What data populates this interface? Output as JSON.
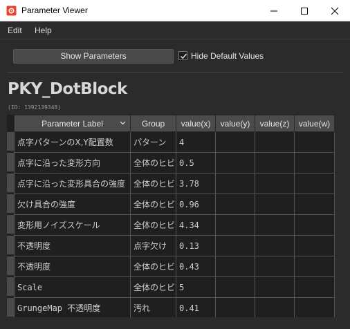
{
  "window": {
    "title": "Parameter Viewer"
  },
  "menu": [
    "Edit",
    "Help"
  ],
  "toolbar": {
    "show_button": "Show Parameters",
    "hide_default_label": "Hide Default Values",
    "hide_default_checked": true
  },
  "block": {
    "name": "PKY_DotBlock",
    "id_text": "(ID: 1392139348)"
  },
  "table": {
    "columns": [
      "Parameter Label",
      "Group",
      "value(x)",
      "value(y)",
      "value(z)",
      "value(w)"
    ],
    "rows": [
      {
        "label": "点字パターンのX,Y配置数",
        "group": "パターン",
        "x": "4",
        "y": "",
        "z": "",
        "w": ""
      },
      {
        "label": "点字に沿った変形方向",
        "group": "全体のヒビ",
        "x": "0.5",
        "y": "",
        "z": "",
        "w": ""
      },
      {
        "label": "点字に沿った変形具合の強度",
        "group": "全体のヒビ",
        "x": "3.78",
        "y": "",
        "z": "",
        "w": ""
      },
      {
        "label": "欠け具合の強度",
        "group": "全体のヒビ",
        "x": "0.96",
        "y": "",
        "z": "",
        "w": ""
      },
      {
        "label": "変形用ノイズスケール",
        "group": "全体のヒビ",
        "x": "4.34",
        "y": "",
        "z": "",
        "w": ""
      },
      {
        "label": "不透明度",
        "group": "点字欠け",
        "x": "0.13",
        "y": "",
        "z": "",
        "w": ""
      },
      {
        "label": "不透明度",
        "group": "全体のヒビ",
        "x": "0.43",
        "y": "",
        "z": "",
        "w": ""
      },
      {
        "label": "Scale",
        "group": "全体のヒビ",
        "x": "5",
        "y": "",
        "z": "",
        "w": ""
      },
      {
        "label": "GrungeMap 不透明度",
        "group": "汚れ",
        "x": "0.41",
        "y": "",
        "z": "",
        "w": ""
      }
    ]
  },
  "icons": {
    "app": "substance-icon",
    "accent": "#e8442b"
  }
}
